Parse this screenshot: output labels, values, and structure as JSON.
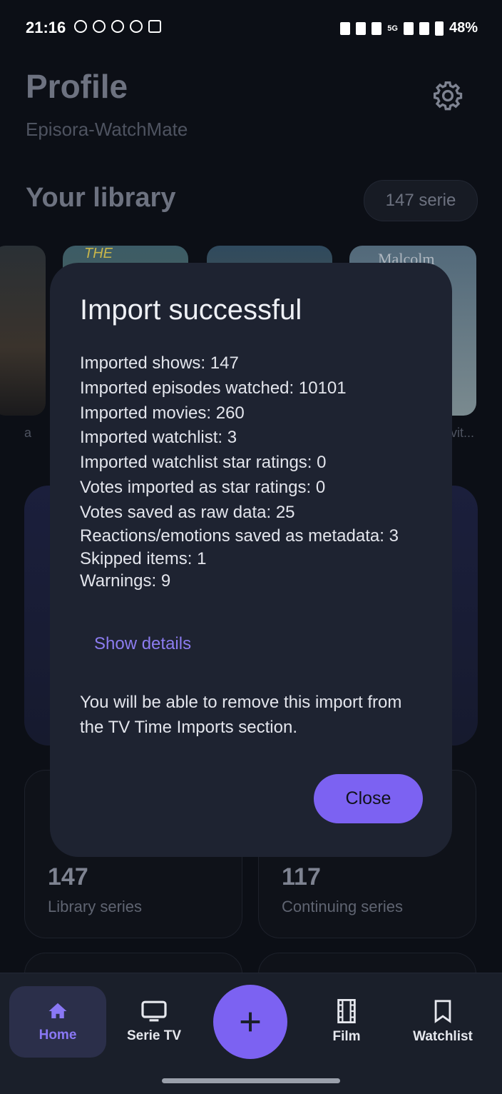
{
  "status_bar": {
    "time": "21:16",
    "network": "5G",
    "battery": "48%"
  },
  "header": {
    "title": "Profile",
    "subtitle": "Episora-WatchMate"
  },
  "library": {
    "title": "Your library",
    "count_pill": "147 serie",
    "posters": [
      {
        "caption": "a"
      },
      {
        "art_text": "THE"
      },
      {
        "caption": ""
      },
      {
        "art_text": "Malcolm",
        "caption": "vit..."
      }
    ]
  },
  "stats": [
    {
      "value": "147",
      "label": "Library series"
    },
    {
      "value": "117",
      "label": "Continuing series"
    }
  ],
  "dialog": {
    "title": "Import successful",
    "lines": [
      "Imported shows: 147",
      "Imported episodes watched: 10101",
      "Imported movies: 260",
      "Imported watchlist: 3",
      "Imported watchlist star ratings: 0",
      "Votes imported as star ratings: 0",
      "Votes saved as raw data: 25",
      "Reactions/emotions saved as metadata: 3",
      "Skipped items: 1",
      "Warnings: 9"
    ],
    "details_link": "Show details",
    "note": "You will be able to remove this import from the TV Time Imports section.",
    "close_label": "Close"
  },
  "nav": {
    "items": [
      {
        "label": "Home",
        "icon": "home-icon"
      },
      {
        "label": "Serie TV",
        "icon": "tv-icon"
      },
      {
        "label": "Film",
        "icon": "film-icon"
      },
      {
        "label": "Watchlist",
        "icon": "bookmark-icon"
      }
    ],
    "fab_icon": "plus-icon"
  },
  "colors": {
    "accent": "#7c62f2",
    "dialog_bg": "#1e2331",
    "background": "#0c0f16"
  }
}
